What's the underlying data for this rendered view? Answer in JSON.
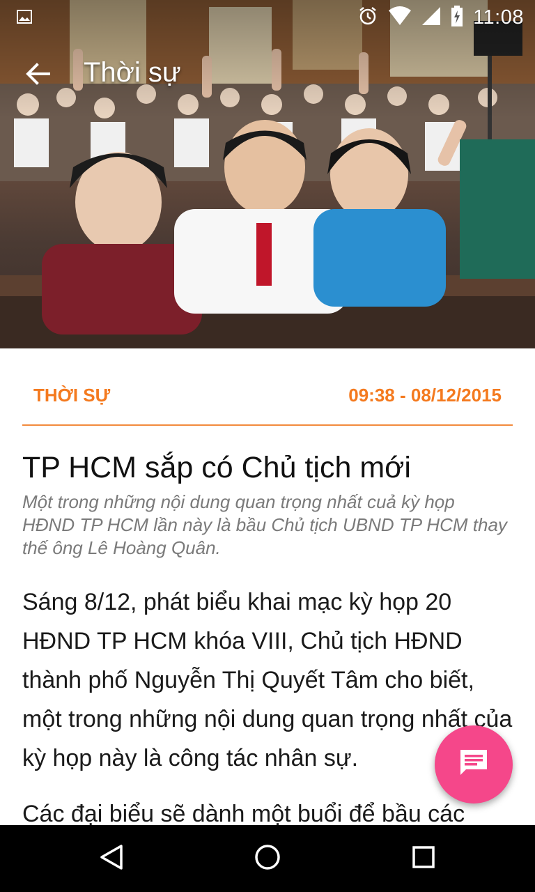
{
  "status_bar": {
    "time": "11:08",
    "icons": [
      "gallery-icon",
      "alarm-icon",
      "wifi-icon",
      "signal-icon",
      "battery-charging-icon"
    ],
    "color": "#ffffff"
  },
  "toolbar": {
    "title": "Thời sự",
    "back_icon": "arrow-back-icon"
  },
  "article": {
    "category": "THỜI SỰ",
    "timestamp": "09:38 - 08/12/2015",
    "headline": "TP HCM sắp có Chủ tịch mới",
    "summary": "Một trong những nội dung quan trọng nhất cuả kỳ họp HĐND TP HCM lần này là bầu Chủ tịch UBND TP HCM thay thế ông Lê Hoàng Quân.",
    "paragraphs": [
      "Sáng 8/12, phát biểu khai mạc kỳ họp 20 HĐND TP HCM khóa VIII, Chủ tịch HĐND thành phố Nguyễn Thị Quyết Tâm cho biết, một trong những nội dung quan trọng nhất của kỳ họp này là công tác nhân sự.",
      "Các đại biểu sẽ dành một buổi để bầu các chức"
    ],
    "accent_color": "#f47a1f"
  },
  "fab": {
    "icon": "comment-icon",
    "color": "#f5478a"
  },
  "nav_bar": {
    "buttons": [
      "back-triangle-icon",
      "home-circle-icon",
      "recents-square-icon"
    ]
  }
}
